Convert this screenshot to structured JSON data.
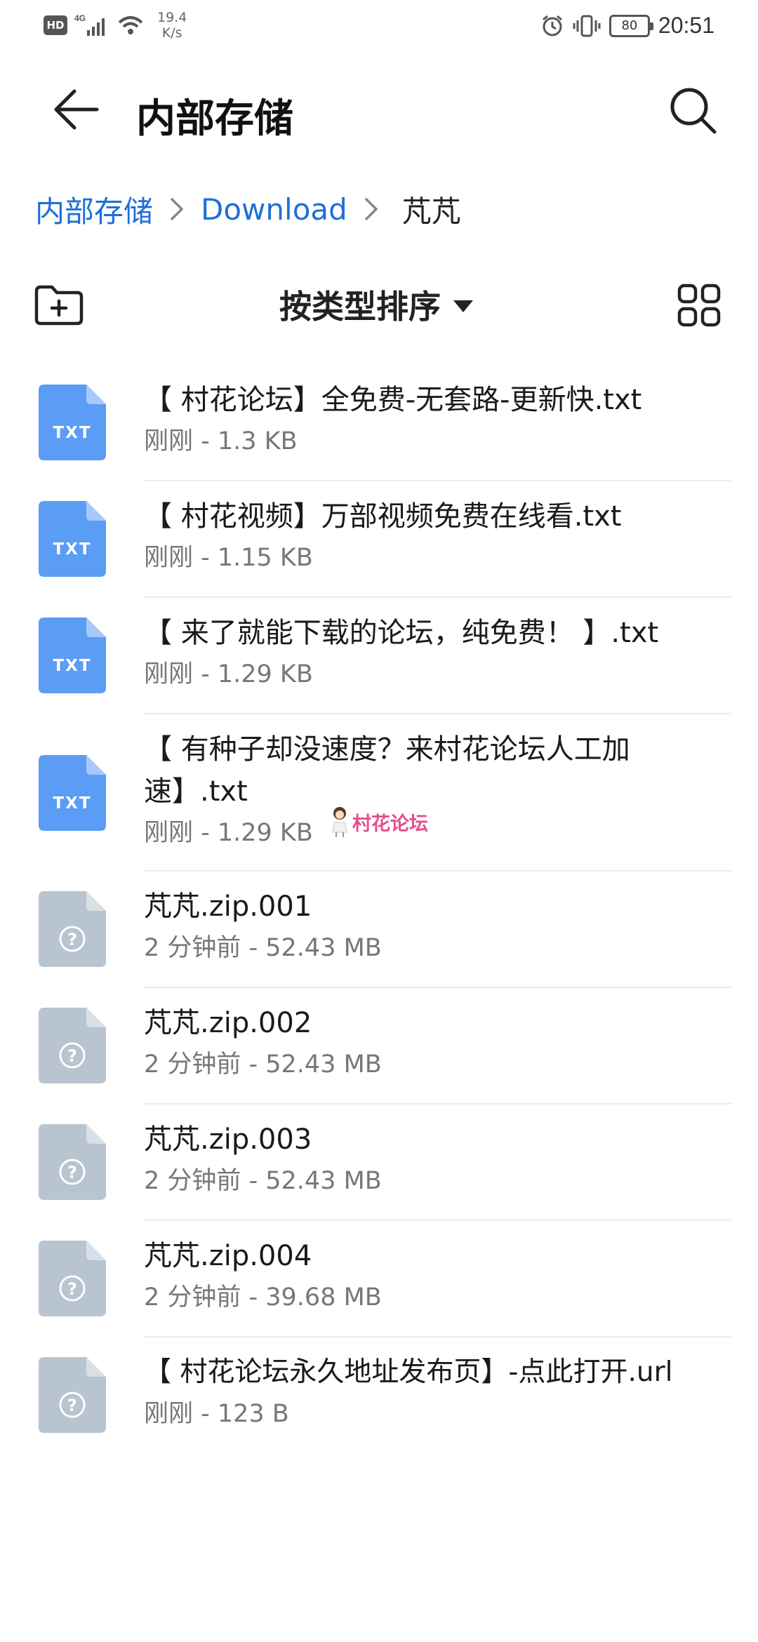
{
  "status_bar": {
    "hd": "HD",
    "network": "4G",
    "speed_value": "19.4",
    "speed_unit": "K/s",
    "battery": "80",
    "time": "20:51"
  },
  "header": {
    "title": "内部存储"
  },
  "breadcrumb": {
    "items": [
      "内部存储",
      "Download"
    ],
    "current": "芃芃"
  },
  "toolbar": {
    "sort_label": "按类型排序"
  },
  "files": [
    {
      "name": "【 村花论坛】全免费-无套路-更新快.txt",
      "meta": "刚刚 - 1.3 KB",
      "type": "TXT"
    },
    {
      "name": "【 村花视频】万部视频免费在线看.txt",
      "meta": "刚刚 - 1.15 KB",
      "type": "TXT"
    },
    {
      "name": "【 来了就能下载的论坛，纯免费！ 】.txt",
      "meta": "刚刚 - 1.29 KB",
      "type": "TXT"
    },
    {
      "name": "【 有种子却没速度？来村花论坛人工加速】.txt",
      "meta": "刚刚 - 1.29 KB",
      "type": "TXT"
    },
    {
      "name": "芃芃.zip.001",
      "meta": "2 分钟前 - 52.43 MB",
      "type": "unknown"
    },
    {
      "name": "芃芃.zip.002",
      "meta": "2 分钟前 - 52.43 MB",
      "type": "unknown"
    },
    {
      "name": "芃芃.zip.003",
      "meta": "2 分钟前 - 52.43 MB",
      "type": "unknown"
    },
    {
      "name": "芃芃.zip.004",
      "meta": "2 分钟前 - 39.68 MB",
      "type": "unknown"
    },
    {
      "name": "【 村花论坛永久地址发布页】-点此打开.url",
      "meta": "刚刚 - 123 B",
      "type": "unknown"
    }
  ],
  "watermark": "村花论坛",
  "colors": {
    "accent": "#1e6fd9",
    "txt_icon": "#5b9cf5",
    "unknown_icon": "#b8c4d0"
  }
}
